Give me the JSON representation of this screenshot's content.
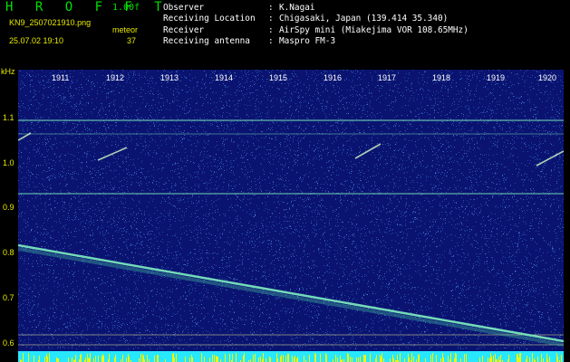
{
  "header": {
    "app_name": "H R O F F T",
    "version": "1.00f",
    "filename": "KN9_2507021910.png",
    "datetime": "25.07.02 19:10",
    "meteor_label": "meteor",
    "meteor_count": "37"
  },
  "info": [
    {
      "key": "Observer",
      "sep": ":",
      "value": "K.Nagai"
    },
    {
      "key": "Receiving Location",
      "sep": ":",
      "value": "Chigasaki, Japan (139.414 35.340)"
    },
    {
      "key": "Receiver",
      "sep": ":",
      "value": "AirSpy mini (Miakejima VOR 108.65MHz)"
    },
    {
      "key": "Receiving antenna",
      "sep": ":",
      "value": "Maspro FM-3"
    }
  ],
  "y_axis": {
    "unit": "kHz",
    "ticks": [
      "1.1",
      "1.0",
      "0.9",
      "0.8",
      "0.7",
      "0.6"
    ]
  },
  "x_axis": {
    "ticks": [
      "1911",
      "1912",
      "1913",
      "1914",
      "1915",
      "1916",
      "1917",
      "1918",
      "1919",
      "1920"
    ]
  },
  "colors": {
    "background": "#000000",
    "plot_bg": "#0a1470",
    "signal": "#7ff0c0",
    "label_yellow": "#e8e800",
    "label_green": "#00e000"
  }
}
